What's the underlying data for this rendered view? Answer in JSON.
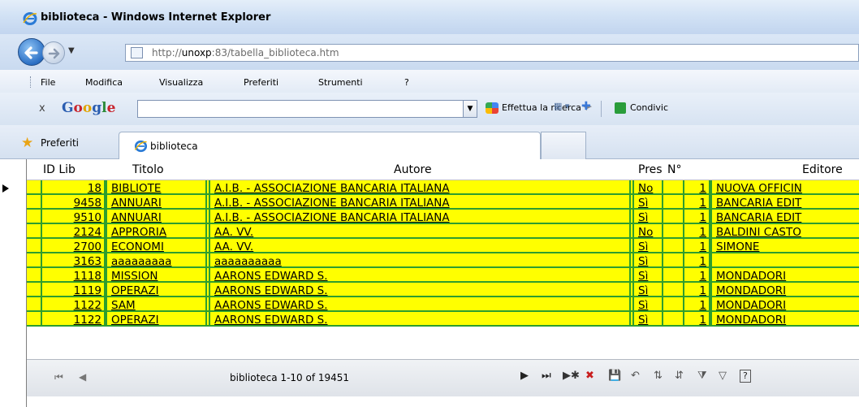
{
  "window": {
    "title": "biblioteca - Windows Internet Explorer"
  },
  "address": {
    "url_prefix": "http://",
    "url_host": "unoxp",
    "url_rest": ":83/tabella_biblioteca.htm"
  },
  "menu": {
    "items": [
      "File",
      "Modifica",
      "Visualizza",
      "Preferiti",
      "Strumenti",
      "?"
    ]
  },
  "google_toolbar": {
    "logo_g": "G",
    "logo_o1": "o",
    "logo_o2": "o",
    "logo_g2": "g",
    "logo_l": "l",
    "logo_e": "e",
    "close": "x",
    "search_value": "",
    "search_button": "Effettua la ricerca",
    "share_label": "Condivic"
  },
  "favorites": {
    "label": "Preferiti",
    "tab_label": "biblioteca"
  },
  "table": {
    "headers": [
      "ID Lib",
      "Titolo",
      "Autore",
      "Pres",
      "N°",
      "Editore"
    ],
    "rows": [
      {
        "id": "18",
        "titolo": "BIBLIOTE",
        "autore": "A.I.B. - ASSOCIAZIONE BANCARIA ITALIANA",
        "pres": "No",
        "n": "1",
        "editore": "NUOVA OFFICIN"
      },
      {
        "id": "9458",
        "titolo": "ANNUARI",
        "autore": "A.I.B. - ASSOCIAZIONE BANCARIA ITALIANA",
        "pres": "Sì",
        "n": "1",
        "editore": "BANCARIA EDIT"
      },
      {
        "id": "9510",
        "titolo": "ANNUARI",
        "autore": "A.I.B. - ASSOCIAZIONE BANCARIA ITALIANA",
        "pres": "Sì",
        "n": "1",
        "editore": "BANCARIA EDIT"
      },
      {
        "id": "2124",
        "titolo": "APPRORIA",
        "autore": "AA. VV.",
        "pres": "No",
        "n": "1",
        "editore": "BALDINI CASTO"
      },
      {
        "id": "2700",
        "titolo": "ECONOMI",
        "autore": "AA. VV.",
        "pres": "Sì",
        "n": "1",
        "editore": "SIMONE"
      },
      {
        "id": "3163",
        "titolo": "aaaaaaaaa",
        "autore": "aaaaaaaaaa",
        "pres": "Sì",
        "n": "1",
        "editore": ""
      },
      {
        "id": "1118",
        "titolo": "MISSION",
        "autore": "AARONS EDWARD S.",
        "pres": "Sì",
        "n": "1",
        "editore": "MONDADORI"
      },
      {
        "id": "1119",
        "titolo": "OPERAZI",
        "autore": "AARONS EDWARD S.",
        "pres": "Sì",
        "n": "1",
        "editore": "MONDADORI"
      },
      {
        "id": "1122",
        "titolo": "SAM",
        "autore": "AARONS EDWARD S.",
        "pres": "Sì",
        "n": "1",
        "editore": "MONDADORI"
      },
      {
        "id": "1122",
        "titolo": "OPERAZI",
        "autore": "AARONS EDWARD S.",
        "pres": "Sì",
        "n": "1",
        "editore": "MONDADORI"
      }
    ]
  },
  "record_nav": {
    "status": "biblioteca 1-10 of 19451"
  },
  "colors": {
    "row_fill": "#ffff00",
    "cell_border": "#2e9e2e"
  }
}
